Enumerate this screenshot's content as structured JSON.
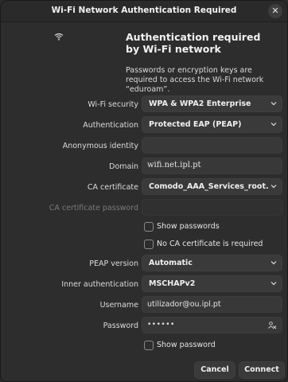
{
  "window": {
    "title": "Wi-Fi Network Authentication Required",
    "close_glyph": "✕"
  },
  "header": {
    "icon": "wifi-icon",
    "heading": "Authentication required by Wi-Fi network",
    "description": "Passwords or encryption keys are required to access the Wi-Fi network “eduroam”."
  },
  "form": {
    "wifi_security": {
      "label": "Wi-Fi security",
      "value": "WPA & WPA2 Enterprise"
    },
    "authentication": {
      "label": "Authentication",
      "value": "Protected EAP (PEAP)"
    },
    "anonymous_identity": {
      "label": "Anonymous identity",
      "value": ""
    },
    "domain": {
      "label": "Domain",
      "value": "wifi.net.ipl.pt"
    },
    "ca_certificate": {
      "label": "CA certificate",
      "value": "Comodo_AAA_Services_root.pem"
    },
    "ca_certificate_password": {
      "label": "CA certificate password",
      "value": ""
    },
    "show_passwords": {
      "label": "Show passwords",
      "checked": false
    },
    "no_ca_required": {
      "label": "No CA certificate is required",
      "checked": false
    },
    "peap_version": {
      "label": "PEAP version",
      "value": "Automatic"
    },
    "inner_authentication": {
      "label": "Inner authentication",
      "value": "MSCHAPv2"
    },
    "username": {
      "label": "Username",
      "value": "utilizador@ou.ipl.pt"
    },
    "password": {
      "label": "Password",
      "value": "••••••",
      "icon": "user-password-icon"
    },
    "show_password": {
      "label": "Show password",
      "checked": false
    }
  },
  "buttons": {
    "cancel": "Cancel",
    "connect": "Connect"
  }
}
